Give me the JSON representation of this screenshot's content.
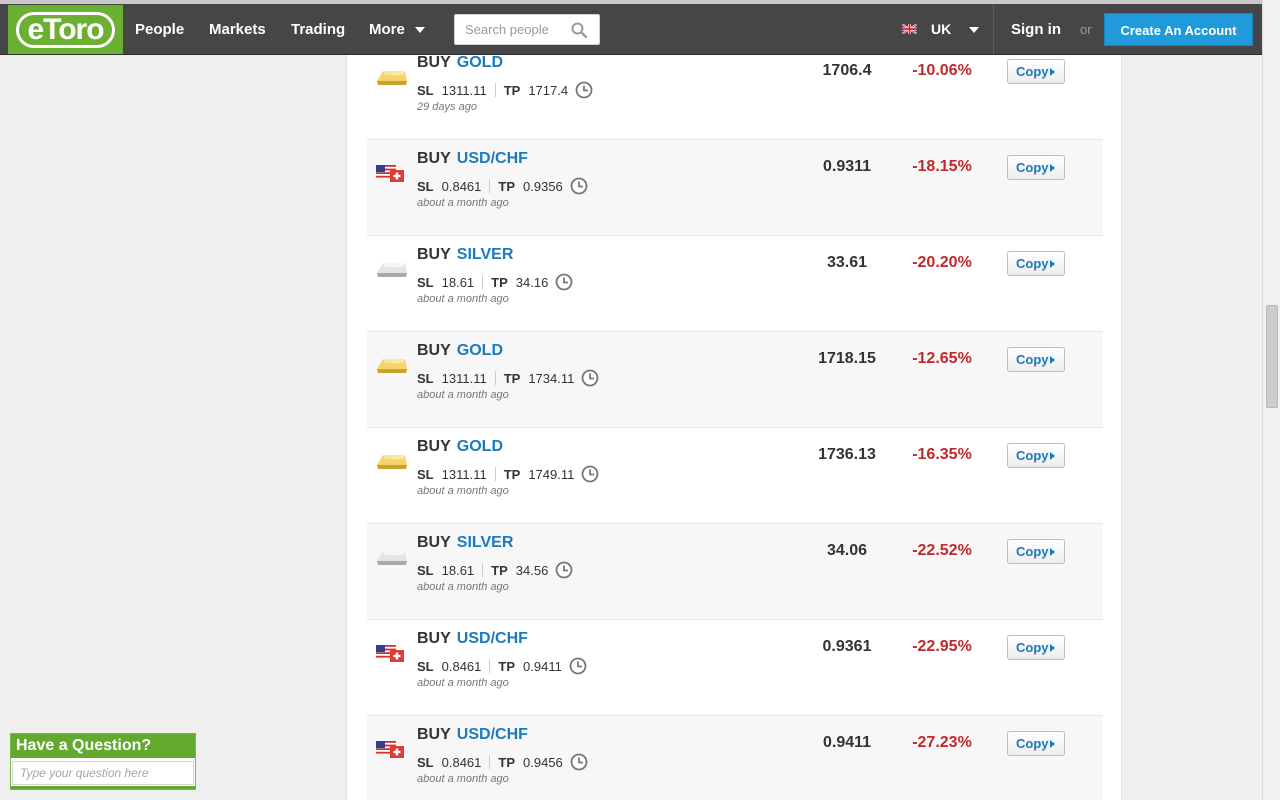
{
  "header": {
    "logo_text": "eToro",
    "nav": [
      "People",
      "Markets",
      "Trading",
      "More"
    ],
    "search_placeholder": "Search people",
    "language": "UK",
    "sign_in": "Sign in",
    "or_text": "or",
    "create_account": "Create An Account"
  },
  "trades": [
    {
      "icon": "gold-bar-icon",
      "action": "BUY",
      "symbol": "GOLD",
      "sl_label": "SL",
      "sl": "1311.11",
      "tp_label": "TP",
      "tp": "1717.4",
      "time": "29 days ago",
      "rate": "1706.4",
      "change": "-10.06%",
      "copy_label": "Copy"
    },
    {
      "icon": "usd-chf-flag-icon",
      "action": "BUY",
      "symbol": "USD/CHF",
      "sl_label": "SL",
      "sl": "0.8461",
      "tp_label": "TP",
      "tp": "0.9356",
      "time": "about a month ago",
      "rate": "0.9311",
      "change": "-18.15%",
      "copy_label": "Copy"
    },
    {
      "icon": "silver-bar-icon",
      "action": "BUY",
      "symbol": "SILVER",
      "sl_label": "SL",
      "sl": "18.61",
      "tp_label": "TP",
      "tp": "34.16",
      "time": "about a month ago",
      "rate": "33.61",
      "change": "-20.20%",
      "copy_label": "Copy"
    },
    {
      "icon": "gold-bar-icon",
      "action": "BUY",
      "symbol": "GOLD",
      "sl_label": "SL",
      "sl": "1311.11",
      "tp_label": "TP",
      "tp": "1734.11",
      "time": "about a month ago",
      "rate": "1718.15",
      "change": "-12.65%",
      "copy_label": "Copy"
    },
    {
      "icon": "gold-bar-icon",
      "action": "BUY",
      "symbol": "GOLD",
      "sl_label": "SL",
      "sl": "1311.11",
      "tp_label": "TP",
      "tp": "1749.11",
      "time": "about a month ago",
      "rate": "1736.13",
      "change": "-16.35%",
      "copy_label": "Copy"
    },
    {
      "icon": "silver-bar-icon",
      "action": "BUY",
      "symbol": "SILVER",
      "sl_label": "SL",
      "sl": "18.61",
      "tp_label": "TP",
      "tp": "34.56",
      "time": "about a month ago",
      "rate": "34.06",
      "change": "-22.52%",
      "copy_label": "Copy"
    },
    {
      "icon": "usd-chf-flag-icon",
      "action": "BUY",
      "symbol": "USD/CHF",
      "sl_label": "SL",
      "sl": "0.8461",
      "tp_label": "TP",
      "tp": "0.9411",
      "time": "about a month ago",
      "rate": "0.9361",
      "change": "-22.95%",
      "copy_label": "Copy"
    },
    {
      "icon": "usd-chf-flag-icon",
      "action": "BUY",
      "symbol": "USD/CHF",
      "sl_label": "SL",
      "sl": "0.8461",
      "tp_label": "TP",
      "tp": "0.9456",
      "time": "about a month ago",
      "rate": "0.9411",
      "change": "-27.23%",
      "copy_label": "Copy"
    }
  ],
  "help": {
    "title": "Have a Question?",
    "placeholder": "Type your question here"
  },
  "colors": {
    "brand_green": "#6cb033",
    "topbar": "#464646",
    "link_blue": "#1a7bbf",
    "loss_red": "#c0282d",
    "create_button": "#1f9bdc"
  }
}
